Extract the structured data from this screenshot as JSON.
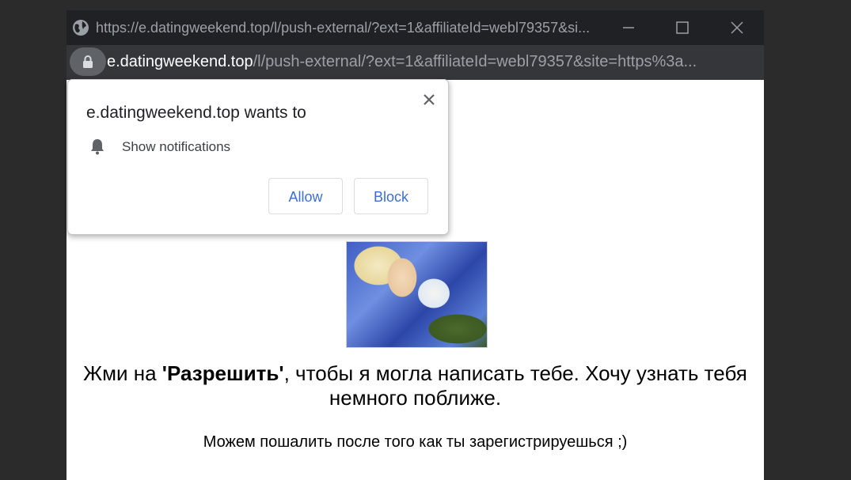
{
  "titlebar": {
    "url": "https://e.datingweekend.top/l/push-external/?ext=1&affiliateId=webl79357&si...",
    "icons": [
      "globe-icon",
      "minimize-icon",
      "maximize-icon",
      "close-icon"
    ]
  },
  "addressbar": {
    "host": "e.datingweekend.top",
    "path": "/l/push-external/?ext=1&affiliateId=webl79357&site=https%3a...",
    "icon": "lock-icon"
  },
  "popup": {
    "title": "e.datingweekend.top wants to",
    "permission_label": "Show notifications",
    "allow_label": "Allow",
    "block_label": "Block",
    "icons": [
      "close-icon",
      "bell-icon"
    ],
    "accent_color": "#3c6fd1"
  },
  "page": {
    "main_text_before": "Жми на ",
    "main_text_bold": "'Разрешить'",
    "main_text_after": ", чтобы я могла написать тебе. Хочу узнать тебя немного поближе.",
    "sub_text": "Можем пошалить после того как ты зарегистрируешься ;)"
  }
}
